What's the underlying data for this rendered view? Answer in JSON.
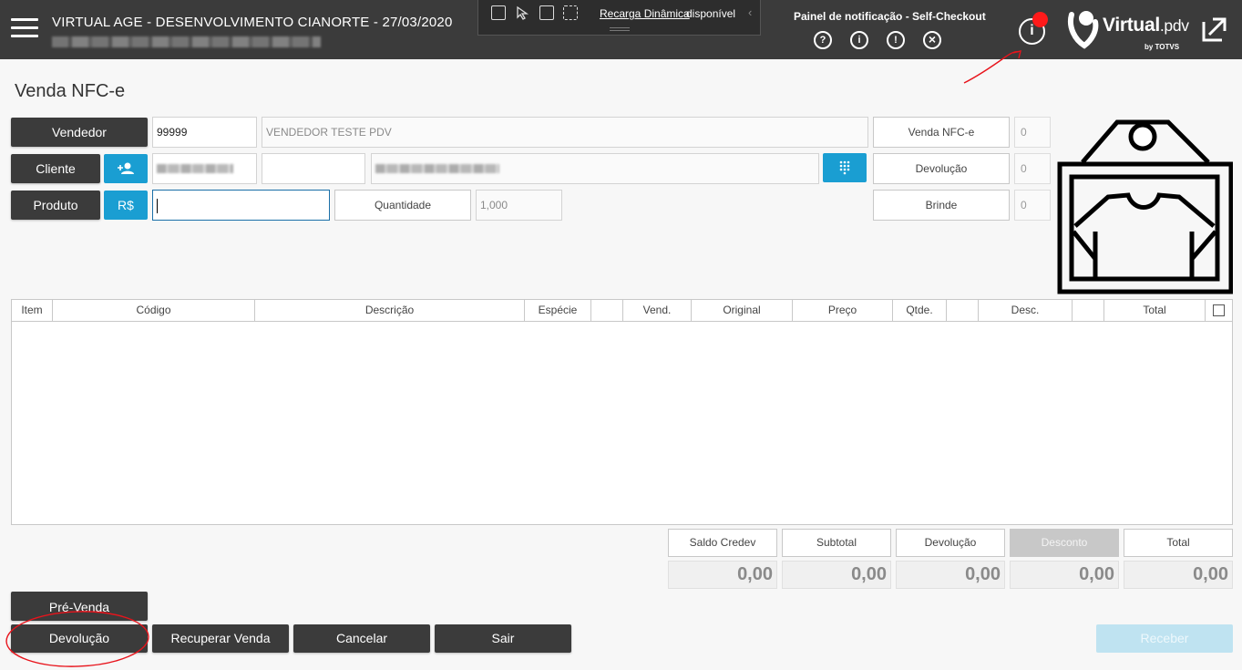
{
  "header": {
    "title": "VIRTUAL AGE - DESENVOLVIMENTO CIANORTE - 27/03/2020",
    "recording": {
      "link_label": "Recarga Dinâmica",
      "status": "disponível"
    },
    "notifications": {
      "title": "Painel de notificação - Self-Checkout",
      "icons": [
        "help-icon",
        "info-icon",
        "alert-icon",
        "close-circle-icon"
      ],
      "glyphs": [
        "?",
        "i",
        "!",
        "×"
      ]
    },
    "info_glyph": "i",
    "brand": {
      "name": "Virtual",
      "suffix": ".pdv",
      "by": "by TOTVS"
    }
  },
  "page": {
    "title": "Venda NFC-e"
  },
  "form": {
    "vendedor": {
      "label": "Vendedor",
      "code": "99999",
      "name": "VENDEDOR TESTE PDV"
    },
    "cliente": {
      "label": "Cliente"
    },
    "produto": {
      "label": "Produto",
      "currency_button": "R$",
      "value": ""
    },
    "quantidade": {
      "label": "Quantidade",
      "value": "1,000"
    }
  },
  "counters": [
    {
      "label": "Venda NFC-e",
      "value": "0"
    },
    {
      "label": "Devolução",
      "value": "0"
    },
    {
      "label": "Brinde",
      "value": "0"
    }
  ],
  "table": {
    "columns": [
      "Item",
      "Código",
      "Descrição",
      "Espécie",
      "",
      "Vend.",
      "Original",
      "Preço",
      "Qtde.",
      "",
      "Desc.",
      "",
      "Total"
    ]
  },
  "totals": [
    {
      "label": "Saldo Credev",
      "value": "0,00"
    },
    {
      "label": "Subtotal",
      "value": "0,00"
    },
    {
      "label": "Devolução",
      "value": "0,00"
    },
    {
      "label": "Desconto",
      "value": "0,00"
    },
    {
      "label": "Total",
      "value": "0,00"
    }
  ],
  "actions": {
    "pre_venda": "Pré-Venda",
    "devolucao": "Devolução",
    "recuperar": "Recuperar Venda",
    "cancelar": "Cancelar",
    "sair": "Sair",
    "receber": "Receber"
  },
  "colors": {
    "topbar": "#3b3b3b",
    "accent": "#1a9ed2",
    "annotation": "#e8141c",
    "receber_disabled": "#bfe3f1",
    "desconto_disabled": "#c8c8c8"
  }
}
